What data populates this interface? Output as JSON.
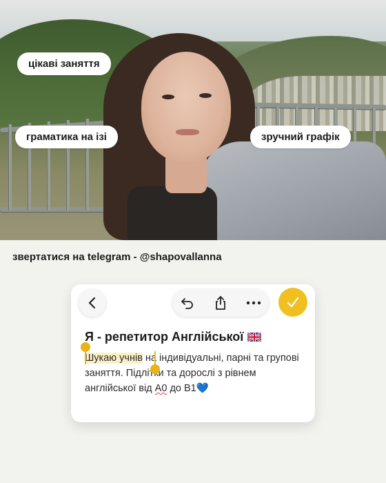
{
  "tags": {
    "tag1": "цікаві заняття",
    "tag2": "граматика на ізі",
    "tag3": "зручний графік"
  },
  "contact": {
    "text": "звертатися на telegram - @shapovallanna"
  },
  "note": {
    "toolbar": {
      "back_icon": "chevron-left-icon",
      "undo_icon": "undo-icon",
      "share_icon": "share-icon",
      "more_icon": "ellipsis-icon",
      "done_icon": "checkmark-icon"
    },
    "title": "Я - репетитор Англійської",
    "title_emoji": "uk-flag",
    "body": {
      "selected": "Шукаю учнів",
      "part1": " на індивідуальні, парні та групові заняття. Підлітки та дорослі з рівнем англійської від ",
      "level_a0": "А0",
      "part2": " до В1",
      "emoji": "💙"
    }
  },
  "colors": {
    "accent": "#f0c020",
    "selection": "#fbefc4",
    "text": "#1a1a1a",
    "background": "#f2f2ef"
  }
}
